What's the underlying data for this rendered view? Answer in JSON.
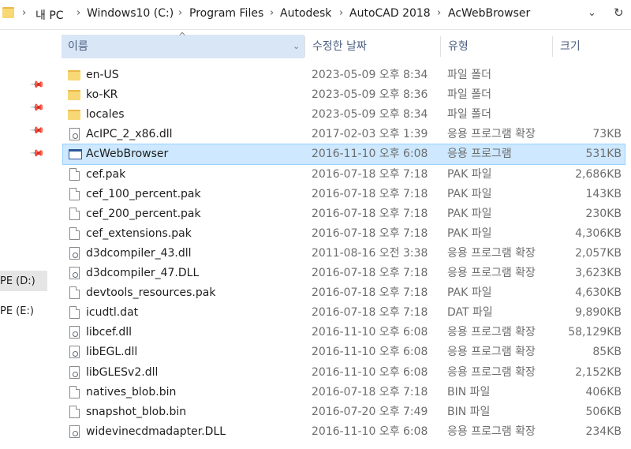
{
  "address": {
    "breadcrumbs": [
      "내 PC",
      "Windows10 (C:)",
      "Program Files",
      "Autodesk",
      "AutoCAD 2018",
      "AcWebBrowser"
    ]
  },
  "nav": {
    "drives": [
      "PE (D:)",
      "PE (E:)"
    ]
  },
  "columns": {
    "name": "이름",
    "date": "수정한 날짜",
    "type": "유형",
    "size": "크기"
  },
  "files": [
    {
      "name": "en-US",
      "date": "2023-05-09 오후 8:34",
      "type": "파일 폴더",
      "size": "",
      "icon": "folder-icon"
    },
    {
      "name": "ko-KR",
      "date": "2023-05-09 오후 8:36",
      "type": "파일 폴더",
      "size": "",
      "icon": "folder-icon"
    },
    {
      "name": "locales",
      "date": "2023-05-09 오후 8:34",
      "type": "파일 폴더",
      "size": "",
      "icon": "folder-icon"
    },
    {
      "name": "AcIPC_2_x86.dll",
      "date": "2017-02-03 오후 1:39",
      "type": "응용 프로그램 확장",
      "size": "73KB",
      "icon": "dll-icon"
    },
    {
      "name": "AcWebBrowser",
      "date": "2016-11-10 오후 6:08",
      "type": "응용 프로그램",
      "size": "531KB",
      "icon": "application-icon",
      "selected": true
    },
    {
      "name": "cef.pak",
      "date": "2016-07-18 오후 7:18",
      "type": "PAK 파일",
      "size": "2,686KB",
      "icon": "file-icon"
    },
    {
      "name": "cef_100_percent.pak",
      "date": "2016-07-18 오후 7:18",
      "type": "PAK 파일",
      "size": "143KB",
      "icon": "file-icon"
    },
    {
      "name": "cef_200_percent.pak",
      "date": "2016-07-18 오후 7:18",
      "type": "PAK 파일",
      "size": "230KB",
      "icon": "file-icon"
    },
    {
      "name": "cef_extensions.pak",
      "date": "2016-07-18 오후 7:18",
      "type": "PAK 파일",
      "size": "4,306KB",
      "icon": "file-icon"
    },
    {
      "name": "d3dcompiler_43.dll",
      "date": "2011-08-16 오전 3:38",
      "type": "응용 프로그램 확장",
      "size": "2,057KB",
      "icon": "dll-icon"
    },
    {
      "name": "d3dcompiler_47.DLL",
      "date": "2016-07-18 오후 7:18",
      "type": "응용 프로그램 확장",
      "size": "3,623KB",
      "icon": "dll-icon"
    },
    {
      "name": "devtools_resources.pak",
      "date": "2016-07-18 오후 7:18",
      "type": "PAK 파일",
      "size": "4,630KB",
      "icon": "file-icon"
    },
    {
      "name": "icudtl.dat",
      "date": "2016-07-18 오후 7:18",
      "type": "DAT 파일",
      "size": "9,890KB",
      "icon": "file-icon"
    },
    {
      "name": "libcef.dll",
      "date": "2016-11-10 오후 6:08",
      "type": "응용 프로그램 확장",
      "size": "58,129KB",
      "icon": "dll-icon"
    },
    {
      "name": "libEGL.dll",
      "date": "2016-11-10 오후 6:08",
      "type": "응용 프로그램 확장",
      "size": "85KB",
      "icon": "dll-icon"
    },
    {
      "name": "libGLESv2.dll",
      "date": "2016-11-10 오후 6:08",
      "type": "응용 프로그램 확장",
      "size": "2,152KB",
      "icon": "dll-icon"
    },
    {
      "name": "natives_blob.bin",
      "date": "2016-07-18 오후 7:18",
      "type": "BIN 파일",
      "size": "406KB",
      "icon": "file-icon"
    },
    {
      "name": "snapshot_blob.bin",
      "date": "2016-07-20 오후 7:49",
      "type": "BIN 파일",
      "size": "506KB",
      "icon": "file-icon"
    },
    {
      "name": "widevinecdmadapter.DLL",
      "date": "2016-11-10 오후 6:08",
      "type": "응용 프로그램 확장",
      "size": "234KB",
      "icon": "dll-icon"
    }
  ]
}
